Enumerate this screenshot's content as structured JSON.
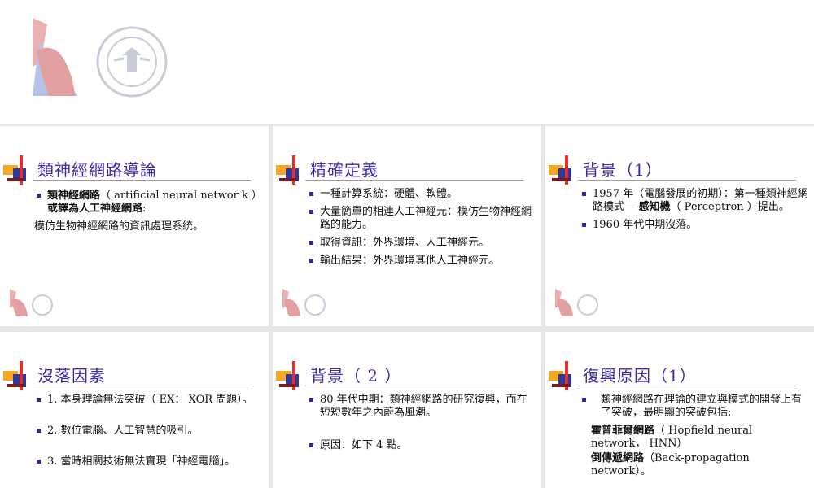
{
  "slides": [
    {
      "title": "類神經網路導論",
      "bullet1": {
        "bold1": "類神經網路",
        "text1": "（ artificial neural networ k ）",
        "bold2": "或譯為人工神經網路",
        "text2": ":"
      },
      "cont": "模仿生物神經網路的資訊處理系統。"
    },
    {
      "title": "精確定義",
      "bullets": [
        "一種計算系統：硬體、軟體。",
        "大量簡單的相連人工神經元：模仿生物神經網路的能力。",
        "取得資訊：外界環境、人工神經元。",
        "輸出結果：外界環境其他人工神經元。"
      ]
    },
    {
      "title": "背景（1）",
      "bullet1": {
        "text1": "1957 年（電腦發展的初期）：第一種類神經網路模式—",
        "bold": " 感知機",
        "text2": "（ Perceptron ）提出。"
      },
      "bullet2": "1960 年代中期沒落。"
    },
    {
      "title": "沒落因素",
      "bullets": [
        "1. 本身理論無法突破（ EX： XOR 問題）。",
        "2. 數位電腦、人工智慧的吸引。",
        "3. 當時相關技術無法實現「神經電腦」。"
      ]
    },
    {
      "title": "背景（ 2 ）",
      "bullets": [
        "80 年代中期：類神經網路的研究復興，而在短短數年之內蔚為風潮。",
        "原因：如下 4 點。"
      ]
    },
    {
      "title": "復興原因（1）",
      "bullet1": "類神經網路在理論的建立與模式的開發上有了突破，最明顯的突破包括:",
      "item1": {
        "bold": "霍普菲爾網路",
        "text": "（ Hopfield neural network， HNN）"
      },
      "item2": {
        "bold": "倒傳遞網路",
        "text": "（Back-propagation network）。"
      }
    }
  ],
  "colors": {
    "title": "#3a2fa0",
    "bullet": "#2a2aa0"
  }
}
